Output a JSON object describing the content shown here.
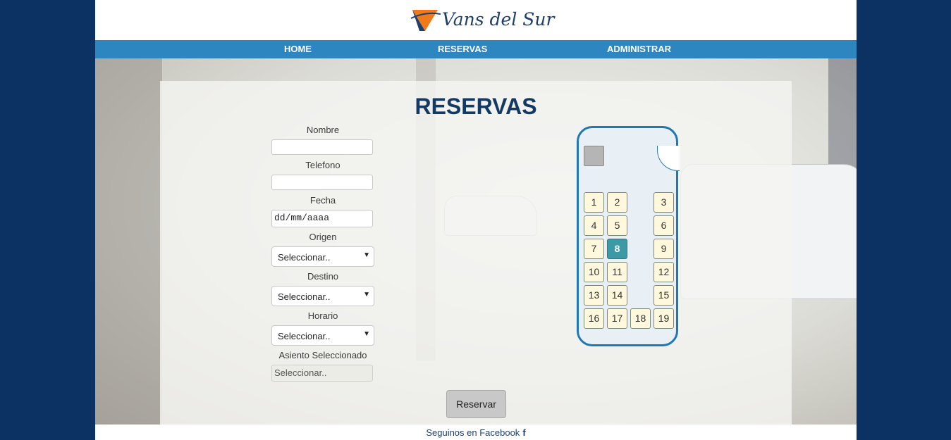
{
  "brand": {
    "name": "Vans del Sur"
  },
  "nav": {
    "items": [
      "HOME",
      "RESERVAS",
      "ADMINISTRAR"
    ]
  },
  "page": {
    "title": "RESERVAS"
  },
  "form": {
    "nombre_label": "Nombre",
    "nombre_value": "",
    "telefono_label": "Telefono",
    "telefono_value": "",
    "fecha_label": "Fecha",
    "fecha_value": "dd/mm/aaaa",
    "origen_label": "Origen",
    "origen_value": "Seleccionar..",
    "destino_label": "Destino",
    "destino_value": "Seleccionar..",
    "horario_label": "Horario",
    "horario_value": "Seleccionar..",
    "asiento_label": "Asiento Seleccionado",
    "asiento_value": "Seleccionar..",
    "submit_label": "Reservar"
  },
  "bus": {
    "seats": [
      "1",
      "2",
      "3",
      "4",
      "5",
      "6",
      "7",
      "8",
      "9",
      "10",
      "11",
      "12",
      "13",
      "14",
      "15",
      "16",
      "17",
      "18",
      "19"
    ],
    "selected_seat": "8"
  },
  "footer": {
    "text": "Seguinos en Facebook",
    "icon": "facebook-icon",
    "icon_glyph": "f"
  },
  "colors": {
    "background": "#0c3263",
    "navbar": "#2e86c1",
    "title": "#133a64",
    "seat": "#fff8dc",
    "seat_selected": "#3c9aa6",
    "bus_outline": "#1f77b4"
  }
}
